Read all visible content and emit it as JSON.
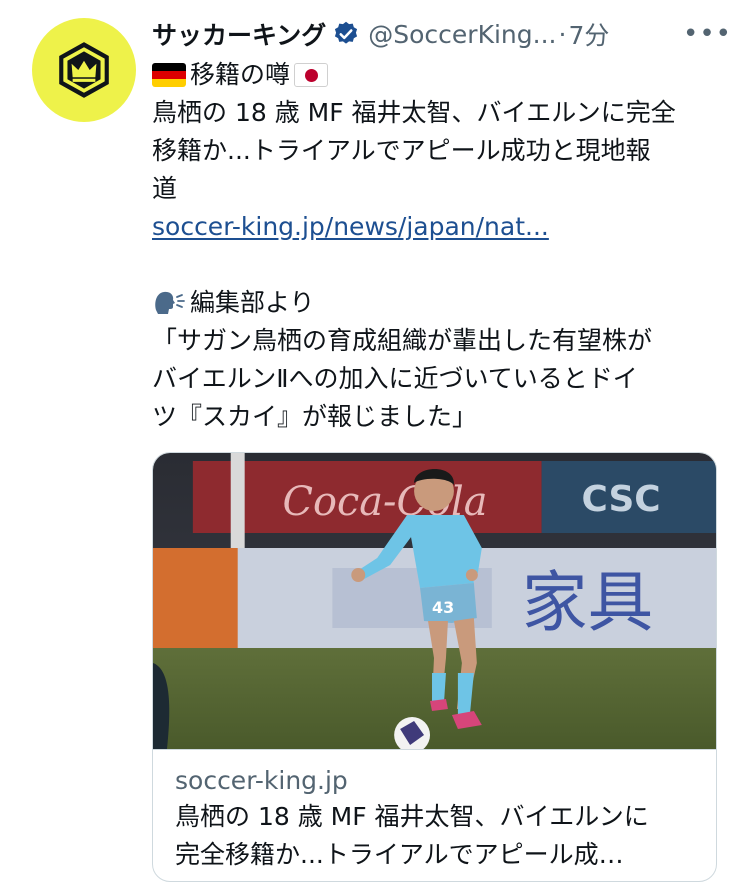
{
  "tweet": {
    "author": {
      "display_name": "サッカーキング",
      "handle": "@SoccerKing...",
      "separator": "·",
      "time": "7分",
      "avatar_icon": "crown-hexagon-logo",
      "avatar_color": "#eef24a",
      "verified": true
    },
    "more_label": "•••",
    "lines": {
      "tag_text": "移籍の噂",
      "headline_1": "鳥栖の 18 歳 MF 福井太智、バイエルンに完全",
      "headline_2": "移籍か...トライアルでアピール成功と現地報",
      "headline_3": "道",
      "link": "soccer-king.jp/news/japan/nat...",
      "editor_label": "編集部より",
      "quote_1": "「サガン鳥栖の育成組織が輩出した有望株が",
      "quote_2": "バイエルンⅡへの加入に近づいているとドイ",
      "quote_3": "ツ『スカイ』が報じました」"
    },
    "card": {
      "domain": "soccer-king.jp",
      "title_1": "鳥栖の 18 歳 MF 福井太智、バイエルンに",
      "title_2": "完全移籍か...トライアルでアピール成…",
      "image": {
        "description_icon": "soccer-player-photo",
        "jersey_number": "43",
        "board_text_1": "Coca-Cola",
        "board_text_2": "CSC",
        "board_text_3": "家具"
      }
    },
    "colors": {
      "link": "#1d4f91",
      "secondary_text": "#536471",
      "verified_badge": "#1d4f91"
    }
  }
}
